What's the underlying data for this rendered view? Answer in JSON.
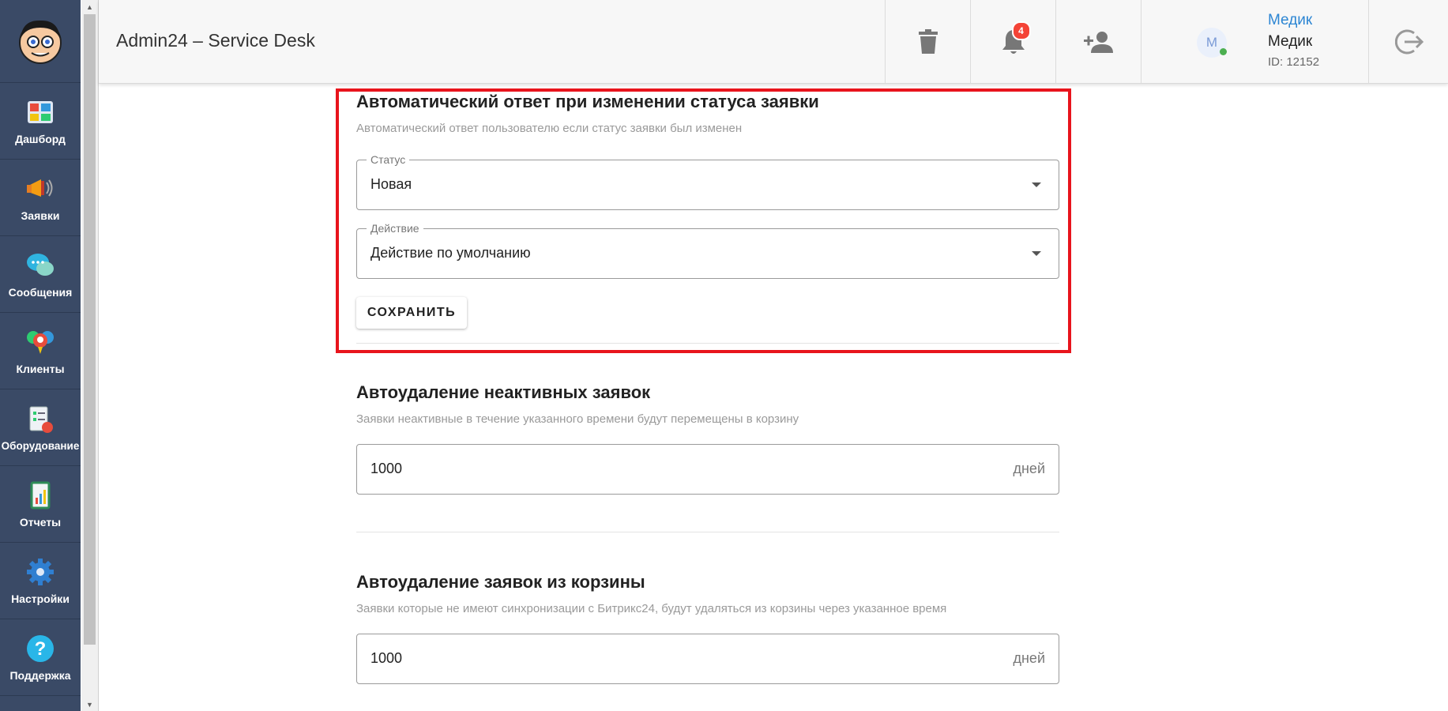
{
  "app": {
    "title": "Admin24 – Service Desk"
  },
  "sidebar": {
    "items": [
      {
        "label": "Дашборд",
        "icon": "dashboard-icon"
      },
      {
        "label": "Заявки",
        "icon": "megaphone-icon"
      },
      {
        "label": "Сообщения",
        "icon": "chat-bubbles-icon"
      },
      {
        "label": "Клиенты",
        "icon": "clients-icon"
      },
      {
        "label": "Оборудование",
        "icon": "equipment-icon"
      },
      {
        "label": "Отчеты",
        "icon": "reports-icon"
      },
      {
        "label": "Настройки",
        "icon": "gear-icon"
      },
      {
        "label": "Поддержка",
        "icon": "help-icon"
      }
    ]
  },
  "header": {
    "notifications_count": "4",
    "user": {
      "avatar_letter": "М",
      "link_name": "Медик",
      "name": "Медик",
      "id_text": "ID: 12152"
    }
  },
  "sections": {
    "auto_reply": {
      "title": "Автоматический ответ при изменении статуса заявки",
      "subtitle": "Автоматический ответ пользователю если статус заявки был изменен",
      "status_label": "Статус",
      "status_value": "Новая",
      "action_label": "Действие",
      "action_value": "Действие по умолчанию",
      "save_label": "СОХРАНИТЬ"
    },
    "auto_delete_inactive": {
      "title": "Автоудаление неактивных заявок",
      "subtitle": "Заявки неактивные в течение указанного времени будут перемещены в корзину",
      "value": "1000",
      "unit": "дней"
    },
    "auto_delete_trash": {
      "title": "Автоудаление заявок из корзины",
      "subtitle": "Заявки которые не имеют синхронизации с Битрикс24, будут удаляться из корзины через указанное время",
      "value": "1000",
      "unit": "дней"
    }
  },
  "colors": {
    "sidebar": "#3a4a66",
    "accent": "#2d86d3",
    "highlight": "#e8141c",
    "badge": "#f44336"
  }
}
